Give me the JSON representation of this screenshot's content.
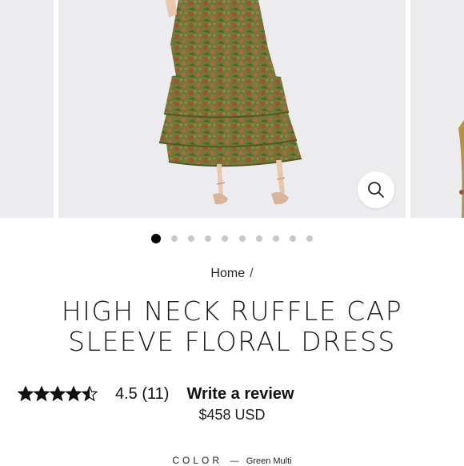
{
  "gallery": {
    "active_slide_index": 0,
    "slide_count": 10,
    "zoom_icon": "search-icon"
  },
  "breadcrumb": {
    "home_label": "Home",
    "separator": "/"
  },
  "product": {
    "title": "HIGH NECK RUFFLE CAP SLEEVE FLORAL DRESS",
    "rating_value": 4.5,
    "rating_max": 5,
    "rating_text": "4.5 (11)",
    "write_review_label": "Write a review",
    "price": "$458 USD"
  },
  "color": {
    "label": "COLOR",
    "dash": "—",
    "selected_value": "Green Multi"
  },
  "colors": {
    "dress_olive": "#6f7a3a",
    "dress_rust": "#a4522e",
    "background": "#ececef",
    "dot_active": "#000000",
    "dot_inactive": "#c8c8c8"
  }
}
